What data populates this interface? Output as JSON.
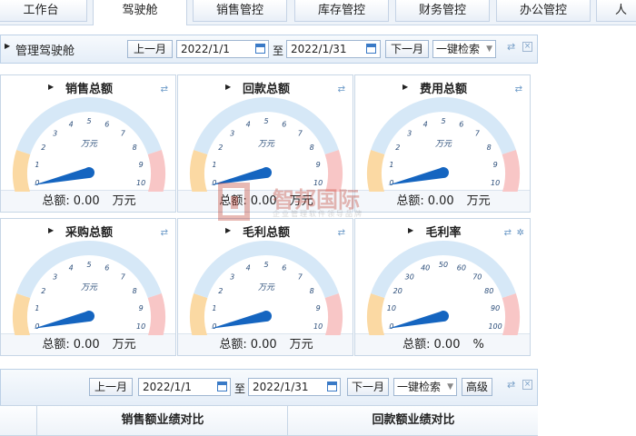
{
  "tabs": [
    "工作台",
    "驾驶舱",
    "销售管控",
    "库存管控",
    "财务管控",
    "办公管控",
    "人"
  ],
  "active_tab": "驾驶舱",
  "panel": {
    "title": "管理驾驶舱",
    "prev_month": "上一月",
    "start_date": "2022/1/1",
    "to": "至",
    "end_date": "2022/1/31",
    "next_month": "下一月",
    "one_key_search": "一键检索"
  },
  "gauges": [
    {
      "title": "销售总额",
      "unit_label": "万元",
      "ticks": [
        "0",
        "1",
        "2",
        "3",
        "4",
        "5",
        "6",
        "7",
        "8",
        "9",
        "10"
      ],
      "footer_label": "总额:",
      "value": "0.00",
      "footer_unit": "万元",
      "gear": false
    },
    {
      "title": "回款总额",
      "unit_label": "万元",
      "ticks": [
        "0",
        "1",
        "2",
        "3",
        "4",
        "5",
        "6",
        "7",
        "8",
        "9",
        "10"
      ],
      "footer_label": "总额:",
      "value": "0.00",
      "footer_unit": "万元",
      "gear": false
    },
    {
      "title": "费用总额",
      "unit_label": "万元",
      "ticks": [
        "0",
        "1",
        "2",
        "3",
        "4",
        "5",
        "6",
        "7",
        "8",
        "9",
        "10"
      ],
      "footer_label": "总额:",
      "value": "0.00",
      "footer_unit": "万元",
      "gear": false
    },
    {
      "title": "采购总额",
      "unit_label": "万元",
      "ticks": [
        "0",
        "1",
        "2",
        "3",
        "4",
        "5",
        "6",
        "7",
        "8",
        "9",
        "10"
      ],
      "footer_label": "总额:",
      "value": "0.00",
      "footer_unit": "万元",
      "gear": false
    },
    {
      "title": "毛利总额",
      "unit_label": "万元",
      "ticks": [
        "0",
        "1",
        "2",
        "3",
        "4",
        "5",
        "6",
        "7",
        "8",
        "9",
        "10"
      ],
      "footer_label": "总额:",
      "value": "0.00",
      "footer_unit": "万元",
      "gear": false
    },
    {
      "title": "毛利率",
      "unit_label": "",
      "ticks": [
        "0",
        "10",
        "20",
        "30",
        "40",
        "50",
        "60",
        "70",
        "80",
        "90",
        "100"
      ],
      "footer_label": "总额:",
      "value": "0.00",
      "footer_unit": "%",
      "gear": true
    }
  ],
  "bottom_toolbar": {
    "prev_month": "上一月",
    "start_date": "2022/1/1",
    "to": "至",
    "end_date": "2022/1/31",
    "next_month": "下一月",
    "one_key_search": "一键检索",
    "advanced": "高级"
  },
  "table_headers": [
    "销售额业绩对比",
    "回款额业绩对比"
  ],
  "watermark": {
    "name": "智邦国际",
    "slogan": "企业管理软件领导品牌"
  },
  "colors": {
    "accent": "#1a5fb4",
    "needle": "#1565c0",
    "arc_blue": "#d6e8f7",
    "arc_orange": "#fbd9a3",
    "arc_red": "#f8c6c6"
  },
  "icons": {
    "refresh": "refresh-icon",
    "close": "close-icon",
    "gear": "gear-icon",
    "calendar": "calendar-icon"
  }
}
